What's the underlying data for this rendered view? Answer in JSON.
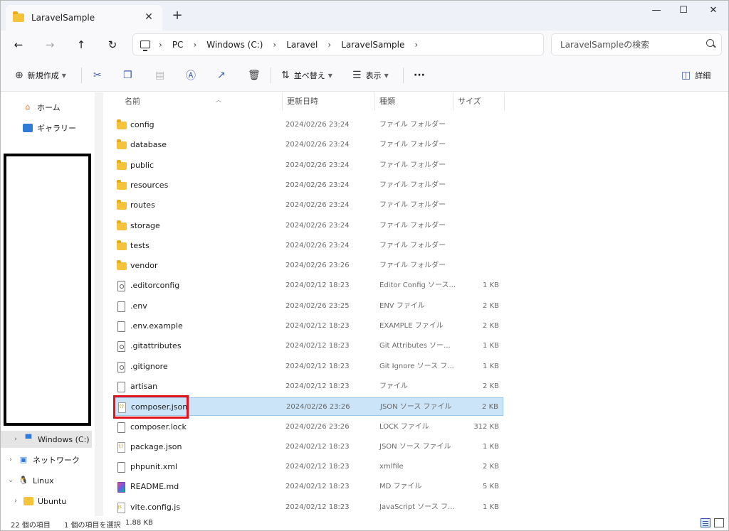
{
  "tab": {
    "title": "LaravelSample",
    "close": "✕",
    "new": "+"
  },
  "window": {
    "minimize": "—",
    "maximize": "☐",
    "close": "✕"
  },
  "nav": {
    "back": "←",
    "forward": "→",
    "up": "↑",
    "refresh": "↻"
  },
  "breadcrumb": [
    "PC",
    "Windows (C:)",
    "Laravel",
    "LaravelSample"
  ],
  "breadcrumb_sep": "›",
  "search": {
    "placeholder": "LaravelSampleの検索"
  },
  "toolbar": {
    "new": "新規作成",
    "sort": "並べ替え",
    "view": "表示",
    "more": "···",
    "details": "詳細"
  },
  "sidebar": {
    "home": "ホーム",
    "gallery": "ギャラリー",
    "drive": "Windows (C:)",
    "network": "ネットワーク",
    "linux": "Linux",
    "ubuntu": "Ubuntu"
  },
  "columns": {
    "name": "名前",
    "date": "更新日時",
    "type": "種類",
    "size": "サイズ"
  },
  "files": [
    {
      "name": "config",
      "date": "2024/02/26 23:24",
      "type": "ファイル フォルダー",
      "size": "",
      "icon": "folder"
    },
    {
      "name": "database",
      "date": "2024/02/26 23:24",
      "type": "ファイル フォルダー",
      "size": "",
      "icon": "folder"
    },
    {
      "name": "public",
      "date": "2024/02/26 23:24",
      "type": "ファイル フォルダー",
      "size": "",
      "icon": "folder"
    },
    {
      "name": "resources",
      "date": "2024/02/26 23:24",
      "type": "ファイル フォルダー",
      "size": "",
      "icon": "folder"
    },
    {
      "name": "routes",
      "date": "2024/02/26 23:24",
      "type": "ファイル フォルダー",
      "size": "",
      "icon": "folder"
    },
    {
      "name": "storage",
      "date": "2024/02/26 23:24",
      "type": "ファイル フォルダー",
      "size": "",
      "icon": "folder"
    },
    {
      "name": "tests",
      "date": "2024/02/26 23:24",
      "type": "ファイル フォルダー",
      "size": "",
      "icon": "folder"
    },
    {
      "name": "vendor",
      "date": "2024/02/26 23:26",
      "type": "ファイル フォルダー",
      "size": "",
      "icon": "folder"
    },
    {
      "name": ".editorconfig",
      "date": "2024/02/12 18:23",
      "type": "Editor Config ソース...",
      "size": "1 KB",
      "icon": "gear"
    },
    {
      "name": ".env",
      "date": "2024/02/26 23:25",
      "type": "ENV ファイル",
      "size": "2 KB",
      "icon": "file"
    },
    {
      "name": ".env.example",
      "date": "2024/02/12 18:23",
      "type": "EXAMPLE ファイル",
      "size": "2 KB",
      "icon": "file"
    },
    {
      "name": ".gitattributes",
      "date": "2024/02/12 18:23",
      "type": "Git Attributes ソー...",
      "size": "1 KB",
      "icon": "gear"
    },
    {
      "name": ".gitignore",
      "date": "2024/02/12 18:23",
      "type": "Git Ignore ソース フ...",
      "size": "1 KB",
      "icon": "gear"
    },
    {
      "name": "artisan",
      "date": "2024/02/12 18:23",
      "type": "ファイル",
      "size": "2 KB",
      "icon": "file"
    },
    {
      "name": "composer.json",
      "date": "2024/02/26 23:26",
      "type": "JSON ソース ファイル",
      "size": "2 KB",
      "icon": "json",
      "selected": true
    },
    {
      "name": "composer.lock",
      "date": "2024/02/26 23:26",
      "type": "LOCK ファイル",
      "size": "312 KB",
      "icon": "file"
    },
    {
      "name": "package.json",
      "date": "2024/02/12 18:23",
      "type": "JSON ソース ファイル",
      "size": "1 KB",
      "icon": "json"
    },
    {
      "name": "phpunit.xml",
      "date": "2024/02/12 18:23",
      "type": "xmlfile",
      "size": "2 KB",
      "icon": "file"
    },
    {
      "name": "README.md",
      "date": "2024/02/12 18:23",
      "type": "MD ファイル",
      "size": "5 KB",
      "icon": "md"
    },
    {
      "name": "vite.config.js",
      "date": "2024/02/12 18:23",
      "type": "JavaScript ソース フ...",
      "size": "1 KB",
      "icon": "js"
    }
  ],
  "status": {
    "count": "22 個の項目",
    "selected": "1 個の項目を選択",
    "size": "1.88 KB"
  },
  "colors": {
    "accent": "#3a5da8",
    "selection": "#cce4f7",
    "highlight": "#e1141d",
    "folder": "#f5c33b"
  }
}
